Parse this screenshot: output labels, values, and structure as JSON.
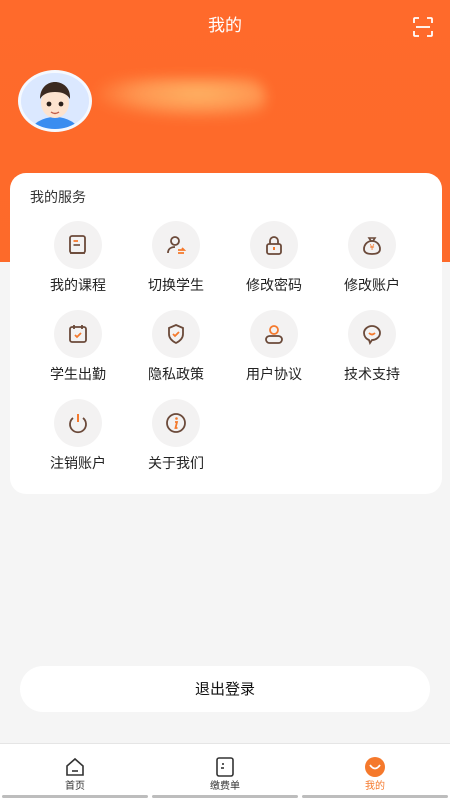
{
  "header": {
    "title": "我的"
  },
  "services": {
    "title": "我的服务",
    "items": [
      {
        "label": "我的课程",
        "icon": "book-icon"
      },
      {
        "label": "切换学生",
        "icon": "switch-student-icon"
      },
      {
        "label": "修改密码",
        "icon": "lock-icon"
      },
      {
        "label": "修改账户",
        "icon": "money-bag-icon"
      },
      {
        "label": "学生出勤",
        "icon": "calendar-check-icon"
      },
      {
        "label": "隐私政策",
        "icon": "shield-check-icon"
      },
      {
        "label": "用户协议",
        "icon": "user-icon"
      },
      {
        "label": "技术支持",
        "icon": "chat-icon"
      },
      {
        "label": "注销账户",
        "icon": "power-icon"
      },
      {
        "label": "关于我们",
        "icon": "info-icon"
      }
    ]
  },
  "logout": {
    "label": "退出登录"
  },
  "tabbar": {
    "tabs": [
      {
        "label": "首页",
        "icon": "home-icon"
      },
      {
        "label": "缴费单",
        "icon": "bill-icon"
      },
      {
        "label": "我的",
        "icon": "profile-icon"
      }
    ],
    "active_index": 2
  },
  "colors": {
    "accent": "#fd6a2a",
    "icon_brown": "#6b4a3a",
    "icon_orange": "#f5792c"
  }
}
